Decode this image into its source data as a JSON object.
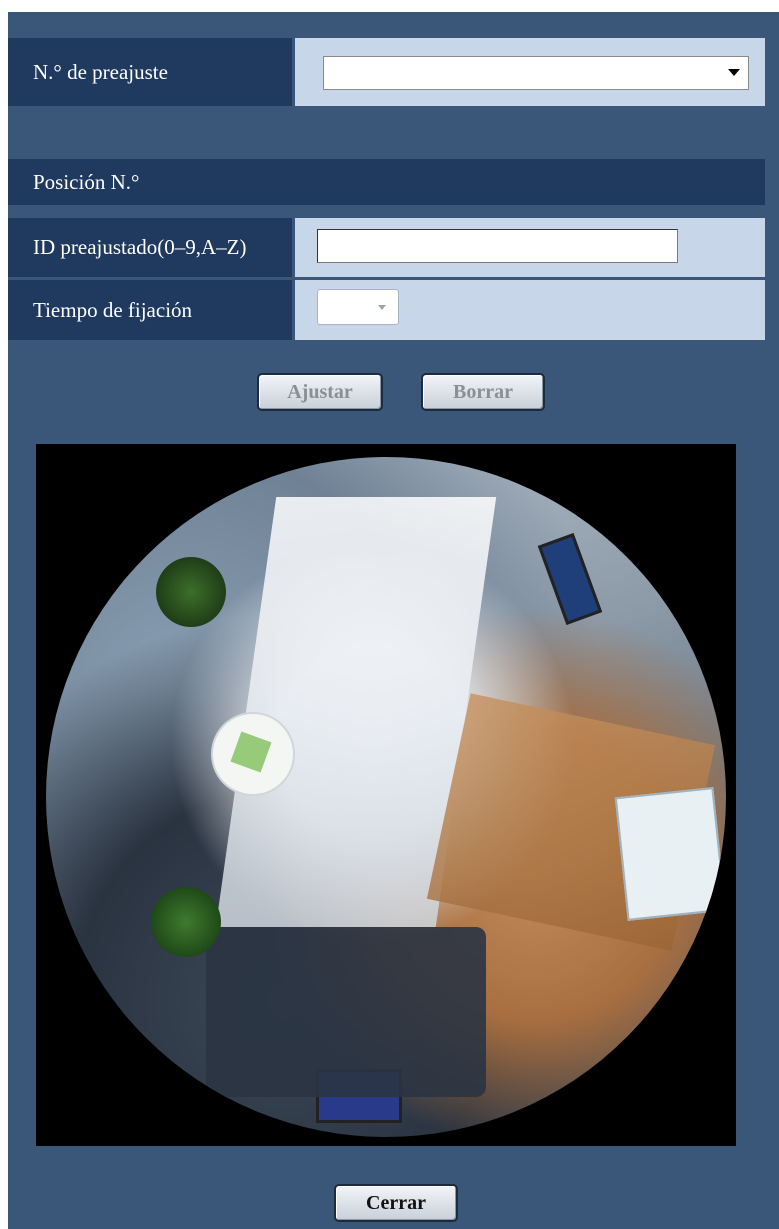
{
  "preset_number": {
    "label": "N.° de preajuste",
    "selected": ""
  },
  "position_section": {
    "title": "Posición N.°"
  },
  "preset_id": {
    "label": "ID preajustado(0–9,A–Z)",
    "value": ""
  },
  "dwell_time": {
    "label": "Tiempo de fijación",
    "selected": ""
  },
  "buttons": {
    "set": "Ajustar",
    "delete": "Borrar",
    "close": "Cerrar"
  },
  "colors": {
    "panel_bg": "#3a5679",
    "label_bg": "#1f3a5e",
    "value_bg": "#c8d6ea"
  }
}
